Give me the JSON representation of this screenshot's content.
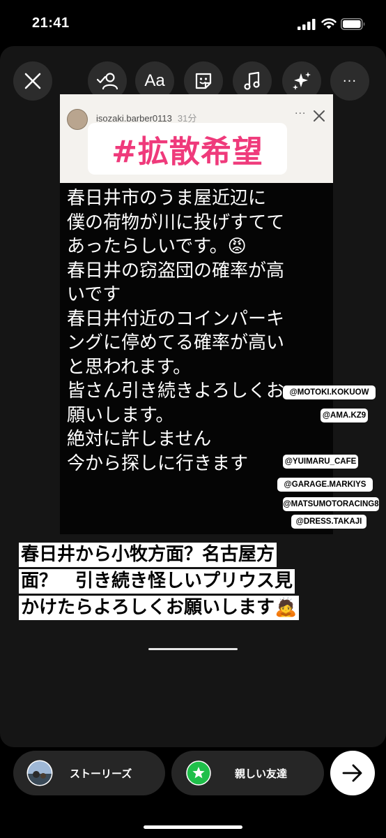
{
  "status_bar": {
    "time": "21:41"
  },
  "toolbar": {
    "text_tool_label": "Aa",
    "more_label": "···"
  },
  "post": {
    "username": "isozaki.barber0113",
    "time_ago": "31分",
    "more_label": "···",
    "hashtag": "#拡散希望",
    "text_lines": [
      "春日井市のうま屋近辺に",
      "僕の荷物が川に投げすてて",
      "あったらしいです。😡",
      "春日井の窃盗団の確率が高",
      "いです",
      "春日井付近のコインパーキ",
      "ングに停めてる確率が高い",
      "と思われます。",
      "皆さん引き続きよろしくお",
      "願いします。",
      "絶対に許しません",
      "今から探しに行きます"
    ]
  },
  "mentions": [
    "@MOTOKI.KOKUOW",
    "@AMA.KZ9",
    "@YUIMARU_CAFE",
    "@GARAGE.MARKIYS",
    "@MATSUMOTORACING8",
    "@DRESS.TAKAJI"
  ],
  "caption_lines": [
    "春日井から小牧方面？名古屋方",
    "面？　引き続き怪しいプリウス見",
    "かけたらよろしくお願いします🙇"
  ],
  "share": {
    "stories_label": "ストーリーズ",
    "close_friends_label": "親しい友達"
  }
}
